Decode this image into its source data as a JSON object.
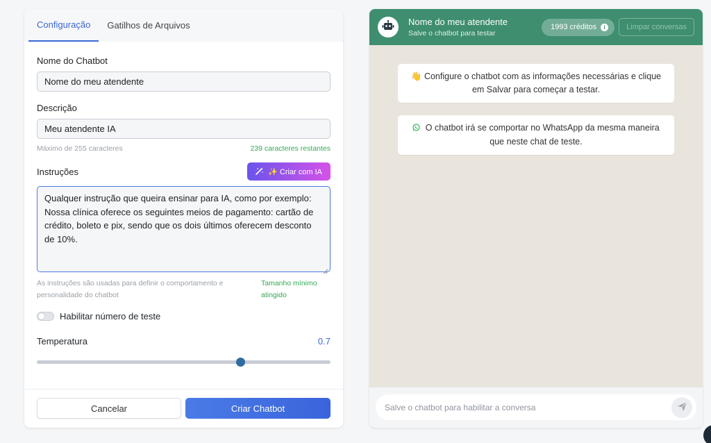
{
  "tabs": [
    {
      "label": "Configuração",
      "active": true
    },
    {
      "label": "Gatilhos de Arquivos",
      "active": false
    }
  ],
  "form": {
    "name_label": "Nome do Chatbot",
    "name_value": "Nome do meu atendente",
    "description_label": "Descrição",
    "description_value": "Meu atendente IA",
    "description_hint": "Máximo de 255 caracteres",
    "description_remaining": "239 caracteres restantes",
    "instructions_label": "Instruções",
    "ai_button_label": "✨ Criar com IA",
    "instructions_value": "Qualquer instrução que queira ensinar para IA, como por exemplo: Nossa clínica oferece os seguintes meios de pagamento: cartão de crédito, boleto e pix, sendo que os dois últimos oferecem desconto de 10%.",
    "instructions_hint": "As instruções são usadas para definir o comportamento e personalidade do chatbot",
    "instructions_status": "Tamanho mínimo atingido",
    "test_number_label": "Habilitar número de teste",
    "test_number_enabled": false,
    "temperature_label": "Temperatura",
    "temperature_value": "0.7",
    "temperature_fraction": 0.7
  },
  "footer": {
    "cancel_label": "Cancelar",
    "create_label": "Criar Chatbot"
  },
  "chat": {
    "title": "Nome do meu atendente",
    "subtitle": "Salve o chatbot para testar",
    "credits": "1993 créditos",
    "clear_label": "Limpar conversas",
    "messages": [
      {
        "icon": "👋",
        "text": "Configure o chatbot com as informações necessárias e clique em Salvar para começar a testar."
      },
      {
        "icon": "whatsapp-icon",
        "text": "O chatbot irá se comportar no WhatsApp da mesma maneira que neste chat de teste."
      }
    ],
    "input_placeholder": "Salve o chatbot para habilitar a conversa"
  },
  "colors": {
    "accent": "#3a67d6",
    "chat_header": "#3e8e6f",
    "success": "#35a853",
    "chat_background": "#e9e5dd"
  }
}
